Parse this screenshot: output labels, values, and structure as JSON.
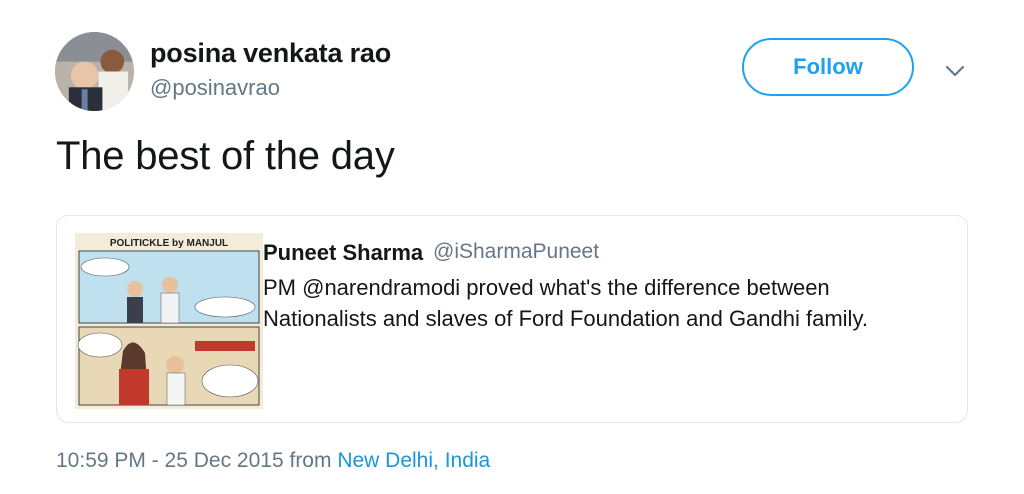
{
  "author": {
    "display_name": "posina venkata rao",
    "handle": "@posinavrao",
    "avatar_icon": "user-avatar-photo"
  },
  "actions": {
    "follow_label": "Follow",
    "more_icon": "chevron-down-icon"
  },
  "tweet": {
    "text": "The best of the day"
  },
  "quoted_tweet": {
    "display_name": "Puneet Sharma",
    "handle": "@iSharmaPuneet",
    "text": "PM @narendramodi proved what's the difference between Nationalists and slaves of Ford Foundation and Gandhi family.",
    "thumbnail": {
      "title": "POLITICKLE by MANJUL"
    }
  },
  "footer": {
    "timestamp": "10:59 PM - 25 Dec 2015",
    "from_label": "from",
    "location": "New Delhi, India"
  },
  "colors": {
    "accent": "#1da1f2",
    "secondary_text": "#657786",
    "link": "#1b95e0",
    "border": "#e1e8ed"
  }
}
